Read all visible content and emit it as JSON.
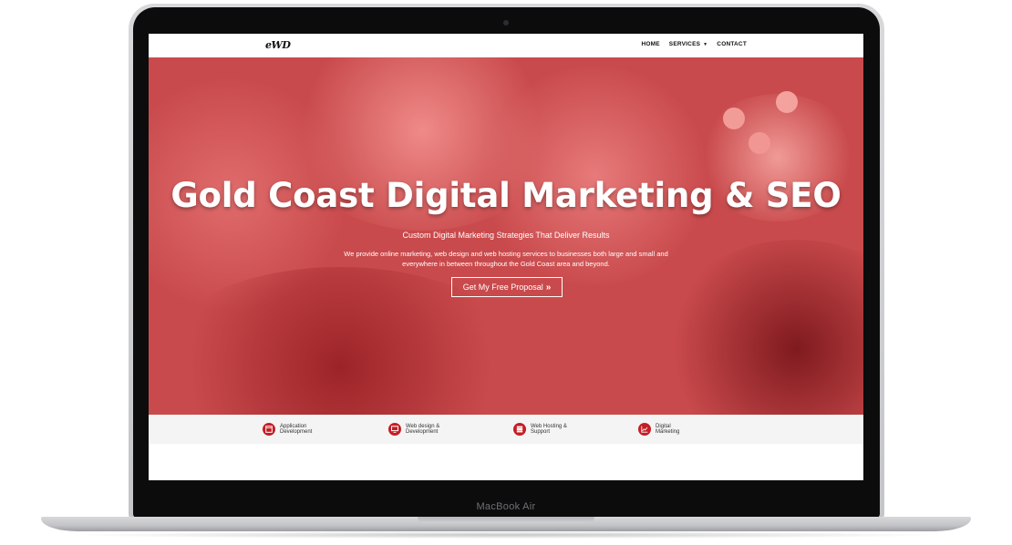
{
  "device": {
    "model_label": "MacBook Air"
  },
  "site": {
    "logo": "eWD",
    "nav": [
      {
        "label": "HOME"
      },
      {
        "label": "SERVICES",
        "has_dropdown": true
      },
      {
        "label": "CONTACT"
      }
    ]
  },
  "hero": {
    "title": "Gold Coast Digital Marketing & SEO",
    "subtitle": "Custom Digital Marketing Strategies That Deliver Results",
    "description_line1": "We provide online marketing, web design and web hosting services to businesses both large and small and",
    "description_line2": "everywhere in between throughout the Gold Coast area and beyond.",
    "cta_label": "Get My Free Proposal",
    "cta_icon": "double-chevron-right-icon",
    "overlay_color": "#c94a4c"
  },
  "features": [
    {
      "line1": "Application",
      "line2": "Development",
      "icon": "app-window-icon"
    },
    {
      "line1": "Web design &",
      "line2": "Development",
      "icon": "monitor-icon"
    },
    {
      "line1": "Web Hosting &",
      "line2": "Support",
      "icon": "server-icon"
    },
    {
      "line1": "Digital",
      "line2": "Marketing",
      "icon": "chart-icon"
    }
  ],
  "colors": {
    "accent_red": "#c41e25",
    "feature_bar_bg": "#f4f4f4"
  }
}
